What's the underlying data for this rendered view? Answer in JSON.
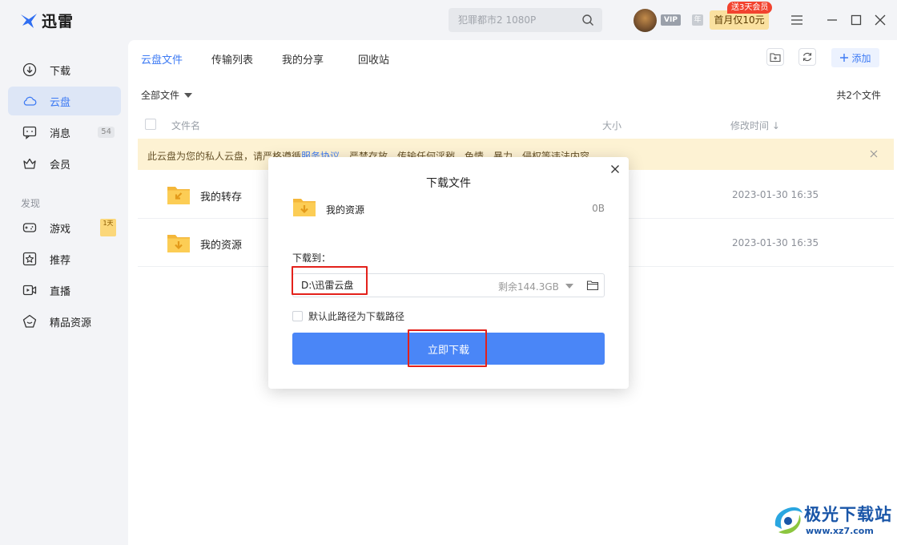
{
  "app": {
    "name": "迅雷"
  },
  "search": {
    "placeholder": "犯罪都市2 1080P"
  },
  "account": {
    "vip": "VIP",
    "year": "年",
    "promo_tag": "送3天会员",
    "promo_label": "首月仅10元"
  },
  "sidebar": {
    "items": [
      {
        "label": "下载",
        "icon": "download-icon"
      },
      {
        "label": "云盘",
        "icon": "cloud-icon",
        "active": true
      },
      {
        "label": "消息",
        "icon": "message-icon",
        "count": "54"
      },
      {
        "label": "会员",
        "icon": "crown-icon"
      }
    ],
    "discover_title": "发现",
    "discover_items": [
      {
        "label": "游戏",
        "icon": "gamepad-icon",
        "badge": "1天"
      },
      {
        "label": "推荐",
        "icon": "star-icon"
      },
      {
        "label": "直播",
        "icon": "live-icon"
      },
      {
        "label": "精品资源",
        "icon": "diamond-icon"
      }
    ]
  },
  "tabs": [
    {
      "label": "云盘文件",
      "active": true
    },
    {
      "label": "传输列表"
    },
    {
      "label": "我的分享"
    },
    {
      "label": "回收站"
    }
  ],
  "toolbar": {
    "add_label": "添加"
  },
  "filter": {
    "label": "全部文件"
  },
  "file_count": "共2个文件",
  "columns": {
    "name": "文件名",
    "size": "大小",
    "modified": "修改时间 ↓"
  },
  "notice": {
    "text_before": "此云盘为您的私人云盘，请严格遵循",
    "link": "服务协议",
    "text_after": "，严禁存放、传输任何淫秽、色情、暴力、侵权等违法内容"
  },
  "files": [
    {
      "name": "我的转存",
      "modified": "2023-01-30 16:35"
    },
    {
      "name": "我的资源",
      "modified": "2023-01-30 16:35"
    }
  ],
  "dialog": {
    "title": "下载文件",
    "file_name": "我的资源",
    "file_size": "0B",
    "download_to_label": "下载到：",
    "path": "D:\\迅雷云盘",
    "remaining": "剩余144.3GB",
    "default_path_label": "默认此路径为下载路径",
    "download_button": "立即下载"
  },
  "watermark": {
    "title": "极光下载站",
    "url": "www.xz7.com"
  },
  "colors": {
    "accent": "#3e7bf4",
    "button": "#4a86f7",
    "highlight": "#e3211b",
    "notice_bg": "#fdf2d3"
  }
}
